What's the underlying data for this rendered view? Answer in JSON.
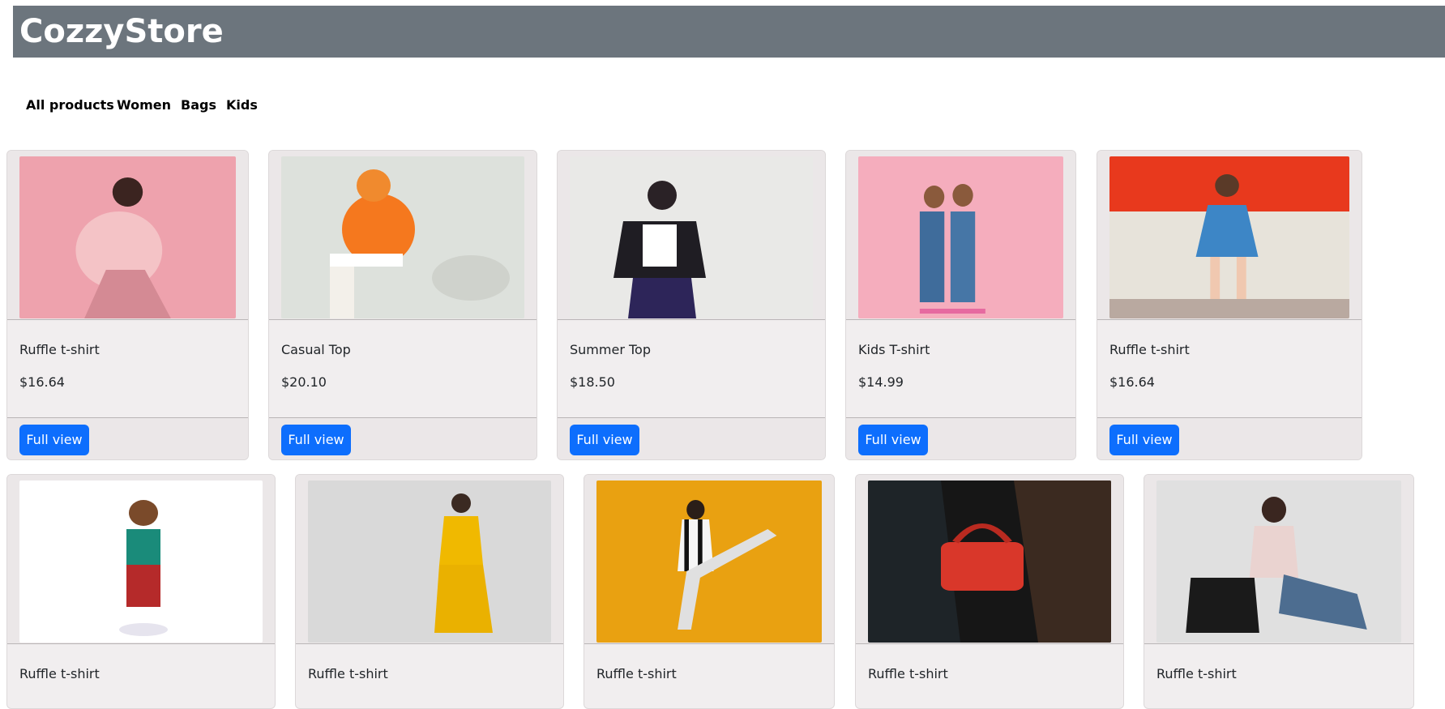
{
  "brand": "CozzyStore",
  "nav": [
    "All products",
    "Women",
    "Bags",
    "Kids"
  ],
  "button_label": "Full view",
  "products": [
    {
      "title": "Ruffle t-shirt",
      "price": "$16.64",
      "image": "woman-pink-fur-coat",
      "bg": "#eea2ad"
    },
    {
      "title": "Casual Top",
      "price": "$20.10",
      "image": "woman-orange-hoodie",
      "bg": "#dde1dc"
    },
    {
      "title": "Summer Top",
      "price": "$18.50",
      "image": "woman-leather-jacket",
      "bg": "#e9e9e7"
    },
    {
      "title": "Kids T-shirt",
      "price": "$14.99",
      "image": "two-kids-denim-overalls",
      "bg": "#f5adbd"
    },
    {
      "title": "Ruffle t-shirt",
      "price": "$16.64",
      "image": "girl-blue-dress-red-wall",
      "bg": "#e7e3da"
    },
    {
      "title": "Ruffle t-shirt",
      "image": "toddler-green-vest",
      "bg": "#ffffff"
    },
    {
      "title": "Ruffle t-shirt",
      "image": "woman-yellow-outfit",
      "bg": "#d9d9d9"
    },
    {
      "title": "Ruffle t-shirt",
      "image": "woman-striped-suit-yellow",
      "bg": "#e9a111"
    },
    {
      "title": "Ruffle t-shirt",
      "image": "red-handbag-car",
      "bg": "#1e2428"
    },
    {
      "title": "Ruffle t-shirt",
      "image": "woman-black-tote-bag",
      "bg": "#e0e0e0"
    }
  ]
}
